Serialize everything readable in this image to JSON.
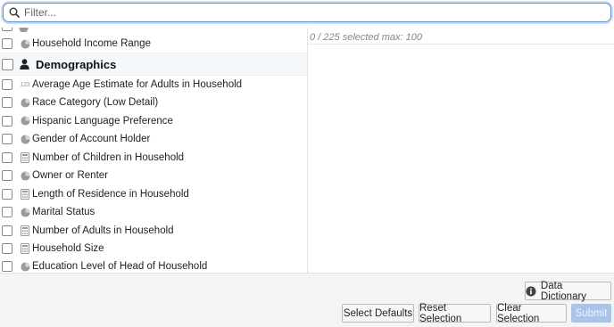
{
  "filter": {
    "placeholder": "Filter..."
  },
  "fields": {
    "cut_row_icon": "pie-icon",
    "first_item": {
      "label": "Household Income Range",
      "icon": "pie-icon"
    },
    "group": {
      "label": "Demographics",
      "icon": "person-icon"
    },
    "items": [
      {
        "label": "Average Age Estimate for Adults in Household",
        "icon": "numeric-icon",
        "badge": "123"
      },
      {
        "label": "Race Category (Low Detail)",
        "icon": "pie-icon"
      },
      {
        "label": "Hispanic Language Preference",
        "icon": "pie-icon"
      },
      {
        "label": "Gender of Account Holder",
        "icon": "pie-icon"
      },
      {
        "label": "Number of Children in Household",
        "icon": "calculator-icon"
      },
      {
        "label": "Owner or Renter",
        "icon": "pie-icon"
      },
      {
        "label": "Length of Residence in Household",
        "icon": "calculator-icon"
      },
      {
        "label": "Marital Status",
        "icon": "pie-icon"
      },
      {
        "label": "Number of Adults in Household",
        "icon": "calculator-icon"
      },
      {
        "label": "Household Size",
        "icon": "calculator-icon"
      },
      {
        "label": "Education Level of Head of Household",
        "icon": "pie-icon"
      }
    ]
  },
  "selection": {
    "status": "0 / 225 selected max: 100"
  },
  "footer": {
    "data_dictionary_label": "Data Dictionary",
    "data_dictionary_icon": "info-icon",
    "select_defaults_label": "Select Defaults",
    "reset_selection_label": "Reset Selection",
    "clear_selection_label": "Clear Selection",
    "submit_label": "Submit"
  },
  "colors": {
    "accent": "#5b8fd1",
    "submit_disabled": "#a9c3ea",
    "group_bg": "#f5f8fb",
    "icon_gray": "#9a9a9a"
  }
}
